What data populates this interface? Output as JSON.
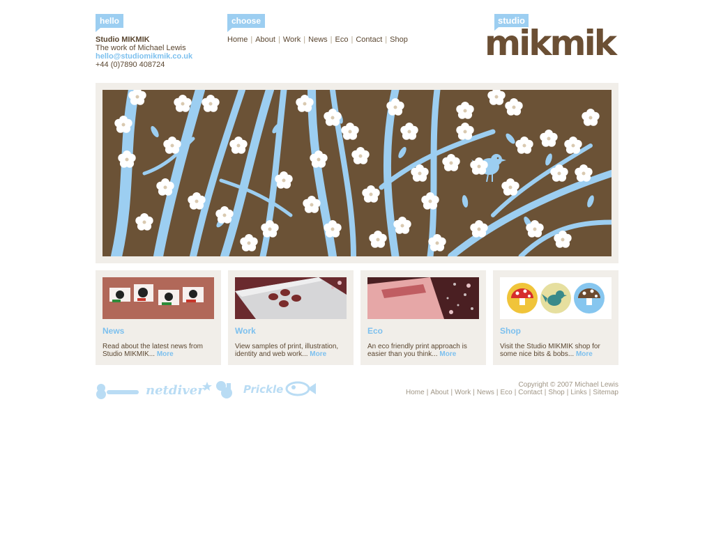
{
  "header": {
    "hello_tag": "hello",
    "choose_tag": "choose",
    "contact": {
      "name": "Studio MIKMIK",
      "tagline": "The work of Michael Lewis",
      "email": "hello@studiomikmik.co.uk",
      "phone": "+44 (0)7890 408724"
    },
    "nav": [
      "Home",
      "About",
      "Work",
      "News",
      "Eco",
      "Contact",
      "Shop"
    ],
    "logo": {
      "studio": "studio",
      "word": "mikmik"
    }
  },
  "cards": [
    {
      "title": "News",
      "desc": "Read about the latest news from Studio MIKMIK... ",
      "more": "More"
    },
    {
      "title": "Work",
      "desc": "View samples of print, illustration, identity and web work... ",
      "more": "More"
    },
    {
      "title": "Eco",
      "desc": "An eco friendly print approach is easier than you think... ",
      "more": "More"
    },
    {
      "title": "Shop",
      "desc": "Visit the Studio MIKMIK shop for some nice bits & bobs... ",
      "more": "More"
    }
  ],
  "footer": {
    "badges": [
      "Prickle",
      "netdiver"
    ],
    "copyright": "Copyright © 2007 Michael Lewis",
    "links": [
      "Home",
      "About",
      "Work",
      "News",
      "Eco",
      "Contact",
      "Shop",
      "Links",
      "Sitemap"
    ]
  },
  "colors": {
    "brown": "#6b5236",
    "blue": "#9ccef1",
    "link_blue": "#7dc0ee",
    "panel": "#f1eee9"
  }
}
